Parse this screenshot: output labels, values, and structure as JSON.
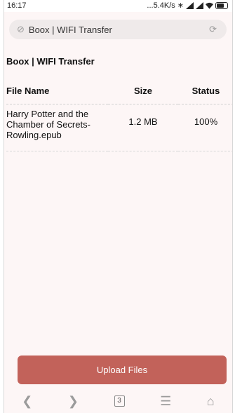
{
  "statusbar": {
    "time": "16:17",
    "network_speed": "...5.4K/s",
    "icons": [
      "bluetooth-icon",
      "signal-icon",
      "signal-icon",
      "wifi-icon",
      "battery-icon"
    ]
  },
  "browser": {
    "url_text": "Boox | WIFI Transfer",
    "tab_count": "3"
  },
  "page": {
    "title": "Boox | WIFI Transfer",
    "table": {
      "headers": {
        "name": "File Name",
        "size": "Size",
        "status": "Status"
      },
      "rows": [
        {
          "name": "Harry Potter and the Chamber of Secrets-Rowling.epub",
          "size": "1.2 MB",
          "status": "100%"
        }
      ]
    },
    "upload_label": "Upload Files"
  },
  "colors": {
    "accent": "#c2625a",
    "background": "#fdf6f6",
    "url_bar": "#efeaea"
  }
}
